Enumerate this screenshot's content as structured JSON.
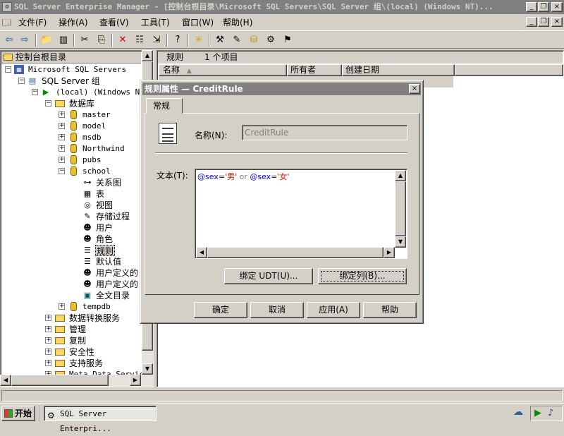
{
  "window": {
    "title": "SQL Server Enterprise Manager - [控制台根目录\\Microsoft SQL Servers\\SQL Server 组\\(local) (Windows NT)..."
  },
  "menu": [
    "文件(F)",
    "操作(A)",
    "查看(V)",
    "工具(T)",
    "窗口(W)",
    "帮助(H)"
  ],
  "tree": {
    "header": "控制台根目录",
    "nodes": {
      "servers": "Microsoft SQL Servers",
      "group": "SQL Server 组",
      "local": "(local) (Windows NT)",
      "databases": "数据库",
      "master": "master",
      "model": "model",
      "msdb": "msdb",
      "northwind": "Northwind",
      "pubs": "pubs",
      "school": "school",
      "diagrams": "关系图",
      "tables": "表",
      "views": "视图",
      "procs": "存储过程",
      "users": "用户",
      "roles": "角色",
      "rules": "规则",
      "defaults": "默认值",
      "udt": "用户定义的",
      "udf": "用户定义的",
      "fulltext": "全文目录",
      "tempdb": "tempdb",
      "dts": "数据转换服务",
      "management": "管理",
      "replication": "复制",
      "security": "安全性",
      "support": "支持服务",
      "metadata": "Meta Data Service"
    }
  },
  "list": {
    "title": "规则",
    "count": "1 个项目",
    "columns": [
      "名称",
      "所有者",
      "创建日期"
    ]
  },
  "dialog": {
    "title": "规则属性 — CreditRule",
    "tab": "常规",
    "name_label": "名称(N):",
    "name_value": "CreditRule",
    "text_label": "文本(T):",
    "text_parts": [
      "@sex=",
      "'男'",
      " or ",
      "@sex=",
      "'女'"
    ],
    "bind_udt": "绑定 UDT(U)...",
    "bind_column": "绑定列(B)...",
    "ok": "确定",
    "cancel": "取消",
    "apply": "应用(A)",
    "help": "帮助"
  },
  "taskbar": {
    "start": "开始",
    "task": "SQL Server Enterpri..."
  },
  "colors": {
    "string_literal": "#ff0000",
    "keyword": "#808080",
    "variable": "#0000ff"
  }
}
